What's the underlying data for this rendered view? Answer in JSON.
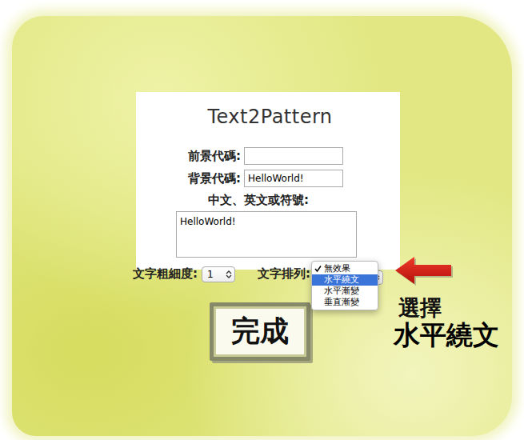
{
  "app": {
    "title": "Text2Pattern"
  },
  "fields": [
    {
      "label": "前景代碼:",
      "value": ""
    },
    {
      "label": "背景代碼:",
      "value": "HelloWorld!"
    }
  ],
  "text_field": {
    "label": "中文、英文或符號:",
    "value": "HelloWorld!"
  },
  "weight": {
    "label": "文字粗細度:",
    "value": "1"
  },
  "arrangement": {
    "label": "文字排列:",
    "expanded": true,
    "options": [
      {
        "label": "無效果",
        "checked": true,
        "selected": false
      },
      {
        "label": "水平繞文",
        "checked": false,
        "selected": true
      },
      {
        "label": "水平漸變",
        "checked": false,
        "selected": false
      },
      {
        "label": "垂直漸變",
        "checked": false,
        "selected": false
      }
    ]
  },
  "submit": {
    "label": "完成"
  },
  "annotation": {
    "lines": [
      "選擇",
      "水平繞文"
    ]
  }
}
